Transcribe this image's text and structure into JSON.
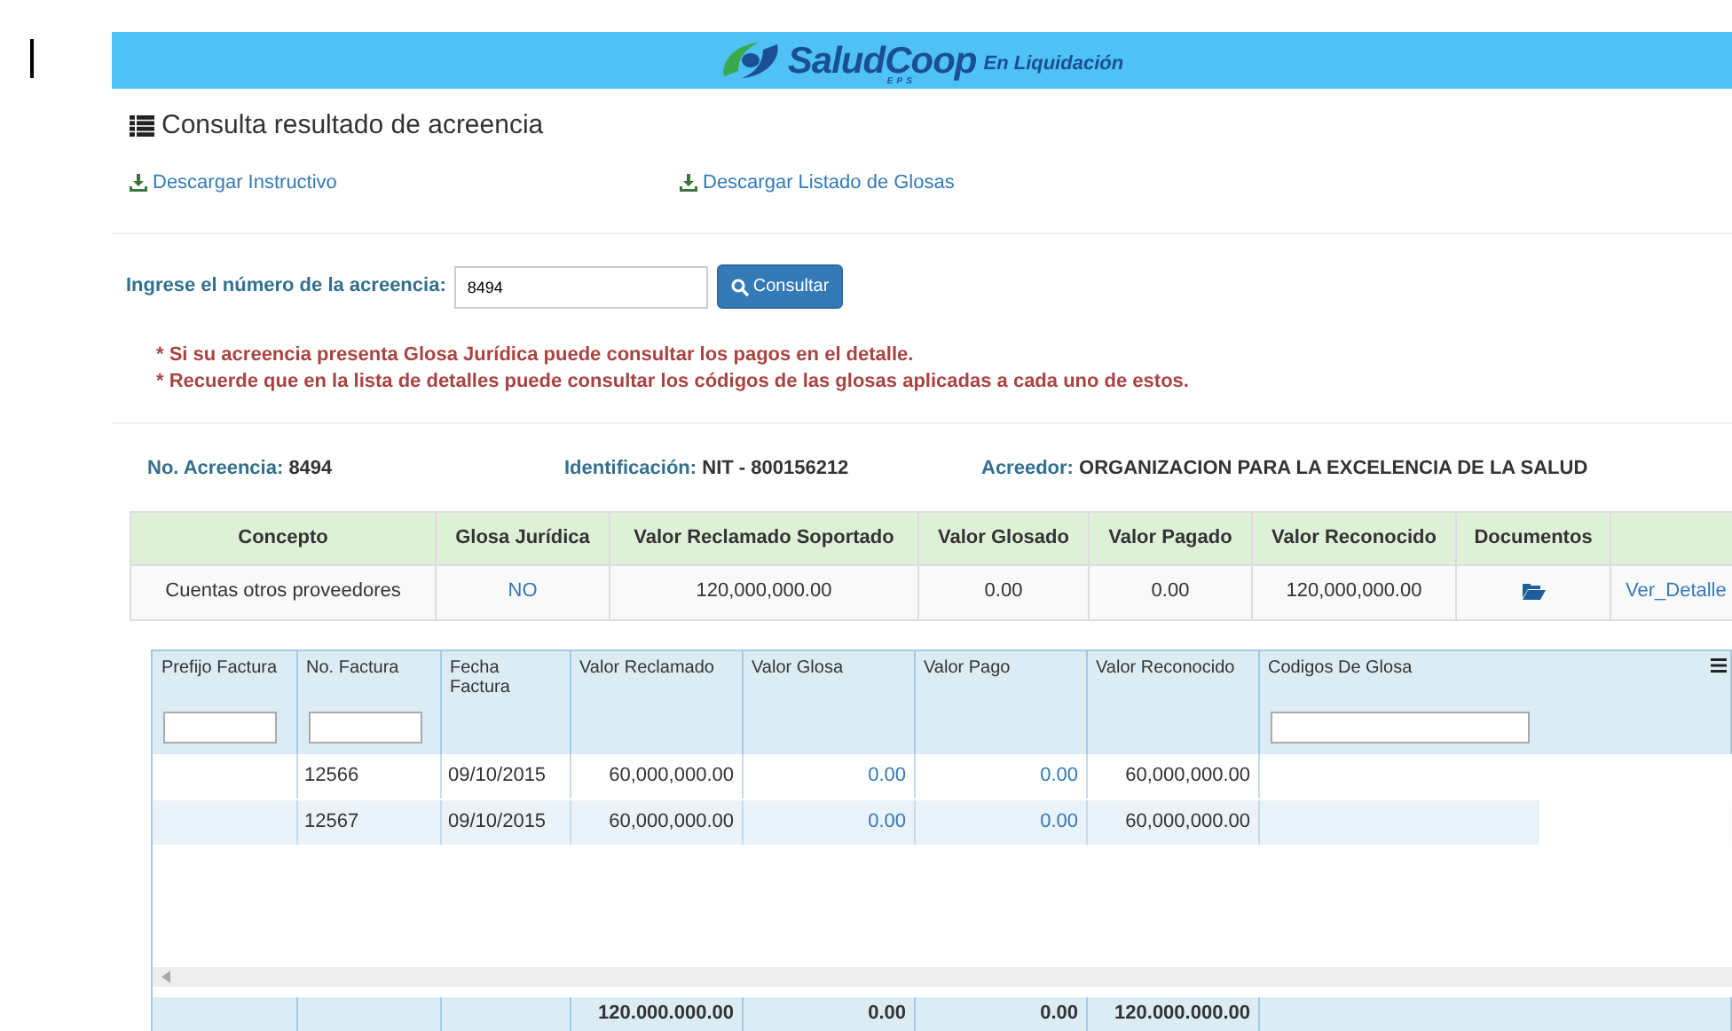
{
  "header": {
    "brand": "SaludCoop",
    "brand_sub": "EPS",
    "tagline": "En Liquidación"
  },
  "title": "Consulta resultado de acreencia",
  "downloads": [
    "Descargar Instructivo",
    "Descargar Listado de Glosas"
  ],
  "search": {
    "label": "Ingrese el número de la acreencia:",
    "value": "8494",
    "button": "Consultar"
  },
  "notes": [
    "* Si su acreencia presenta Glosa Jurídica puede consultar los pagos en el detalle.",
    "* Recuerde que en la lista de detalles puede consultar los códigos de las glosas aplicadas a cada uno de estos."
  ],
  "summary": [
    {
      "label": "No. Acreencia:",
      "value": "8494"
    },
    {
      "label": "Identificación:",
      "value": "NIT - 800156212"
    },
    {
      "label": "Acreedor:",
      "value": "ORGANIZACION PARA LA EXCELENCIA DE LA SALUD"
    }
  ],
  "concepts": {
    "columns": [
      "Concepto",
      "Glosa Jurídica",
      "Valor Reclamado Soportado",
      "Valor Glosado",
      "Valor Pagado",
      "Valor Reconocido",
      "Documentos"
    ],
    "rows": [
      {
        "concepto": "Cuentas otros proveedores",
        "glosa_juridica": "NO",
        "valor_reclamado": "120,000,000.00",
        "valor_glosado": "0.00",
        "valor_pagado": "0.00",
        "valor_reconocido": "120,000,000.00",
        "link": "Ver_Detalle"
      }
    ]
  },
  "grid": {
    "columns": [
      {
        "label": "Prefijo Factura",
        "filter": true
      },
      {
        "label": "No. Factura",
        "filter": true
      },
      {
        "label": "Fecha Factura",
        "filter": false
      },
      {
        "label": "Valor Reclamado",
        "filter": false
      },
      {
        "label": "Valor Glosa",
        "filter": false
      },
      {
        "label": "Valor Pago",
        "filter": false
      },
      {
        "label": "Valor Reconocido",
        "filter": false
      },
      {
        "label": "Codigos De Glosa",
        "filter": true
      }
    ],
    "rows": [
      [
        "",
        "12566",
        "09/10/2015",
        "60,000,000.00",
        "0.00",
        "0.00",
        "60,000,000.00",
        ""
      ],
      [
        "",
        "12567",
        "09/10/2015",
        "60,000,000.00",
        "0.00",
        "0.00",
        "60,000,000.00",
        ""
      ]
    ],
    "totals": {
      "valor_reclamado": "120.000.000.00",
      "valor_glosa": "0.00",
      "valor_pago": "0.00",
      "valor_reconocido": "120.000.000.00"
    }
  }
}
